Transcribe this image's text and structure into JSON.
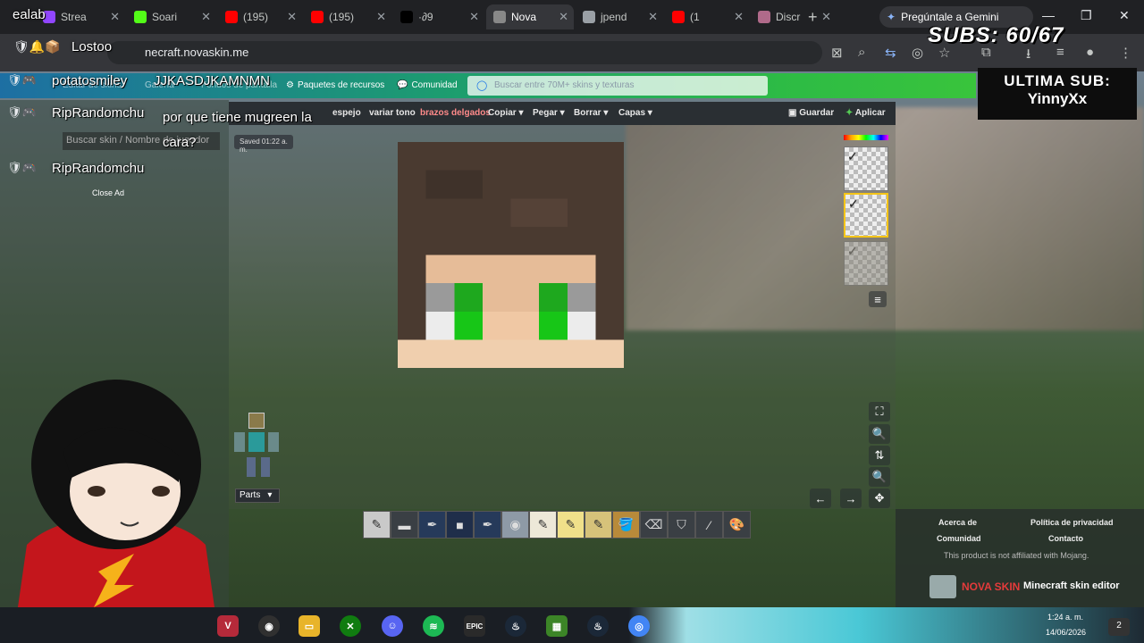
{
  "browser": {
    "tabs": [
      {
        "label": "Strea",
        "color": "#9146ff"
      },
      {
        "label": "Soari",
        "color": "#53fc18"
      },
      {
        "label": "(195)",
        "color": "#ff0000"
      },
      {
        "label": "(195)",
        "color": "#ff0000"
      },
      {
        "label": "·∂9",
        "color": "#000000"
      },
      {
        "label": "Nova",
        "color": "#888888",
        "active": true
      },
      {
        "label": "jpend",
        "color": "#9aa0a6"
      },
      {
        "label": "(1",
        "color": "#ff0000"
      },
      {
        "label": "Discr",
        "color": "#b06a8a"
      }
    ],
    "gemini_label": "Pregúntale a Gemini",
    "url": "necraft.novaskin.me",
    "new_tab_glyph": "+"
  },
  "site": {
    "nav": {
      "links": [
        "Editar de skins",
        "Galería",
        "Fondos de pantalla",
        "Paquetes de recursos",
        "Comunidad"
      ],
      "search_placeholder": "Buscar entre 70M+ skins y texturas"
    },
    "editor_menu": [
      "espejo",
      "variar tono",
      "brazos delgados",
      "Copiar ▾",
      "Pegar ▾",
      "Borrar ▾",
      "Capas ▾"
    ],
    "save_label": "Guardar",
    "apply_label": "Aplicar",
    "saved_status": "Saved 01:22 a. m.",
    "player_search_placeholder": "Buscar skin / Nombre de jugador",
    "close_ad": "Close Ad",
    "parts_label": "Parts",
    "footer": {
      "about": "Acerca de",
      "privacy": "Política de privacidad",
      "community": "Comunidad",
      "contact": "Contacto",
      "disclaimer": "This product is not affiliated with Mojang.",
      "brand": "NOVA SKIN",
      "brand_tagline": "Minecraft skin editor"
    }
  },
  "stream_overlay": {
    "subs_counter": "SUBS: 60/67",
    "last_sub_title": "ULTIMA SUB:",
    "last_sub_name": "YinnyXx",
    "chat": [
      {
        "user": "Lostoo",
        "text": ""
      },
      {
        "user": "potatosmiley",
        "text": "JJKASDJKAMNMN"
      },
      {
        "user": "RipRandomchu",
        "text": "por que tiene mugreen la cara?"
      },
      {
        "user": "RipRandomchu",
        "text": ""
      }
    ],
    "partial_text": "ealab"
  },
  "taskbar": {
    "apps": [
      "valorant",
      "obs",
      "explorer",
      "xbox",
      "discord",
      "spotify",
      "epic",
      "steam",
      "minecraft",
      "steam2",
      "chrome"
    ],
    "time": "1:24 a. m.",
    "date": "14/06/2026",
    "notification_count": "2"
  },
  "colors": {
    "nav_start": "#1d6fa3",
    "nav_end": "#39c43c",
    "chrome_bg": "#202124"
  }
}
